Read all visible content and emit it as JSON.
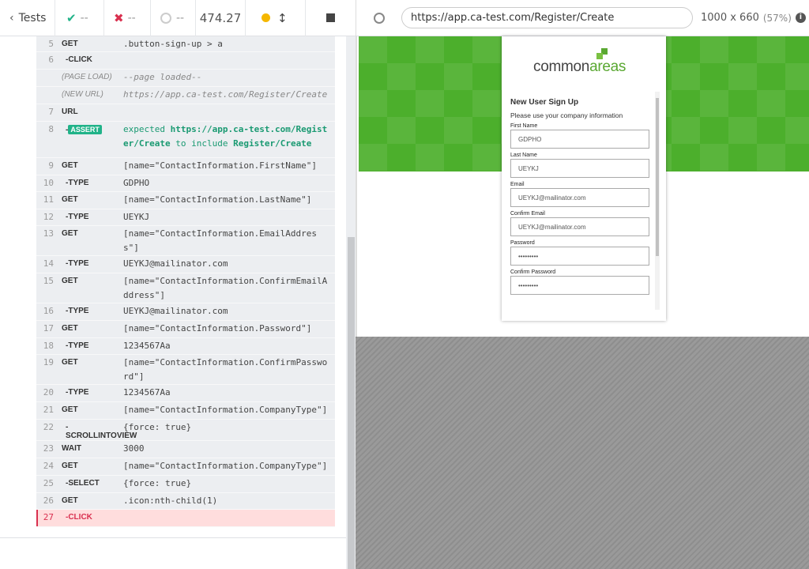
{
  "toolbar": {
    "tests_label": "Tests",
    "passed": "--",
    "failed": "--",
    "pending": "--",
    "duration": "474.27"
  },
  "commands": [
    {
      "num": "5",
      "cmd": "GET",
      "msg": ".button-sign-up > a"
    },
    {
      "num": "6",
      "cmd": "-CLICK",
      "msg": ""
    },
    {
      "num": "",
      "cmd": "(PAGE LOAD)",
      "msg": "--page loaded--"
    },
    {
      "num": "",
      "cmd": "(NEW URL)",
      "msg": "https://app.ca-test.com/Register/Create"
    },
    {
      "num": "7",
      "cmd": "URL",
      "msg": ""
    },
    {
      "num": "8",
      "cmd": "-",
      "badge": "ASSERT",
      "msg_prefix": "expected",
      "msg_url": "https://app.ca-test.com/Register/Create",
      "msg_mid": "to include",
      "msg_target": "Register/Create"
    },
    {
      "num": "9",
      "cmd": "GET",
      "msg": "[name=\"ContactInformation.FirstName\"]"
    },
    {
      "num": "10",
      "cmd": "-TYPE",
      "msg": "GDPHO"
    },
    {
      "num": "11",
      "cmd": "GET",
      "msg": "[name=\"ContactInformation.LastName\"]"
    },
    {
      "num": "12",
      "cmd": "-TYPE",
      "msg": "UEYKJ"
    },
    {
      "num": "13",
      "cmd": "GET",
      "msg": "[name=\"ContactInformation.EmailAddress\"]"
    },
    {
      "num": "14",
      "cmd": "-TYPE",
      "msg": "UEYKJ@mailinator.com"
    },
    {
      "num": "15",
      "cmd": "GET",
      "msg": "[name=\"ContactInformation.ConfirmEmailAddress\"]"
    },
    {
      "num": "16",
      "cmd": "-TYPE",
      "msg": "UEYKJ@mailinator.com"
    },
    {
      "num": "17",
      "cmd": "GET",
      "msg": "[name=\"ContactInformation.Password\"]"
    },
    {
      "num": "18",
      "cmd": "-TYPE",
      "msg": "1234567Aa"
    },
    {
      "num": "19",
      "cmd": "GET",
      "msg": "[name=\"ContactInformation.ConfirmPassword\"]"
    },
    {
      "num": "20",
      "cmd": "-TYPE",
      "msg": "1234567Aa"
    },
    {
      "num": "21",
      "cmd": "GET",
      "msg": "[name=\"ContactInformation.CompanyType\"]"
    },
    {
      "num": "22",
      "cmd": "-SCROLLINTOVIEW",
      "msg": "{force: true}"
    },
    {
      "num": "23",
      "cmd": "WAIT",
      "msg": "3000"
    },
    {
      "num": "24",
      "cmd": "GET",
      "msg": "[name=\"ContactInformation.CompanyType\"]"
    },
    {
      "num": "25",
      "cmd": "-SELECT",
      "msg": "{force: true}"
    },
    {
      "num": "26",
      "cmd": "GET",
      "msg": ".icon:nth-child(1)"
    },
    {
      "num": "27",
      "cmd": "-CLICK",
      "msg": ""
    }
  ],
  "browser": {
    "url": "https://app.ca-test.com/Register/Create",
    "viewport": "1000 x 660",
    "scale": "(57%)"
  },
  "page": {
    "logo_common": "common",
    "logo_areas": "areas",
    "form_title": "New User Sign Up",
    "form_subtitle": "Please use your company information",
    "fields": [
      {
        "label": "First Name",
        "value": "GDPHO"
      },
      {
        "label": "Last Name",
        "value": "UEYKJ"
      },
      {
        "label": "Email",
        "value": "UEYKJ@mailinator.com"
      },
      {
        "label": "Confirm Email",
        "value": "UEYKJ@mailinator.com"
      },
      {
        "label": "Password",
        "value": "•••••••••"
      },
      {
        "label": "Confirm Password",
        "value": "•••••••••"
      }
    ]
  },
  "colors": {
    "accent_green": "#4caf2c",
    "assert_badge": "#21b389",
    "fail_red": "#d9304f",
    "running_yellow": "#f5b700"
  }
}
